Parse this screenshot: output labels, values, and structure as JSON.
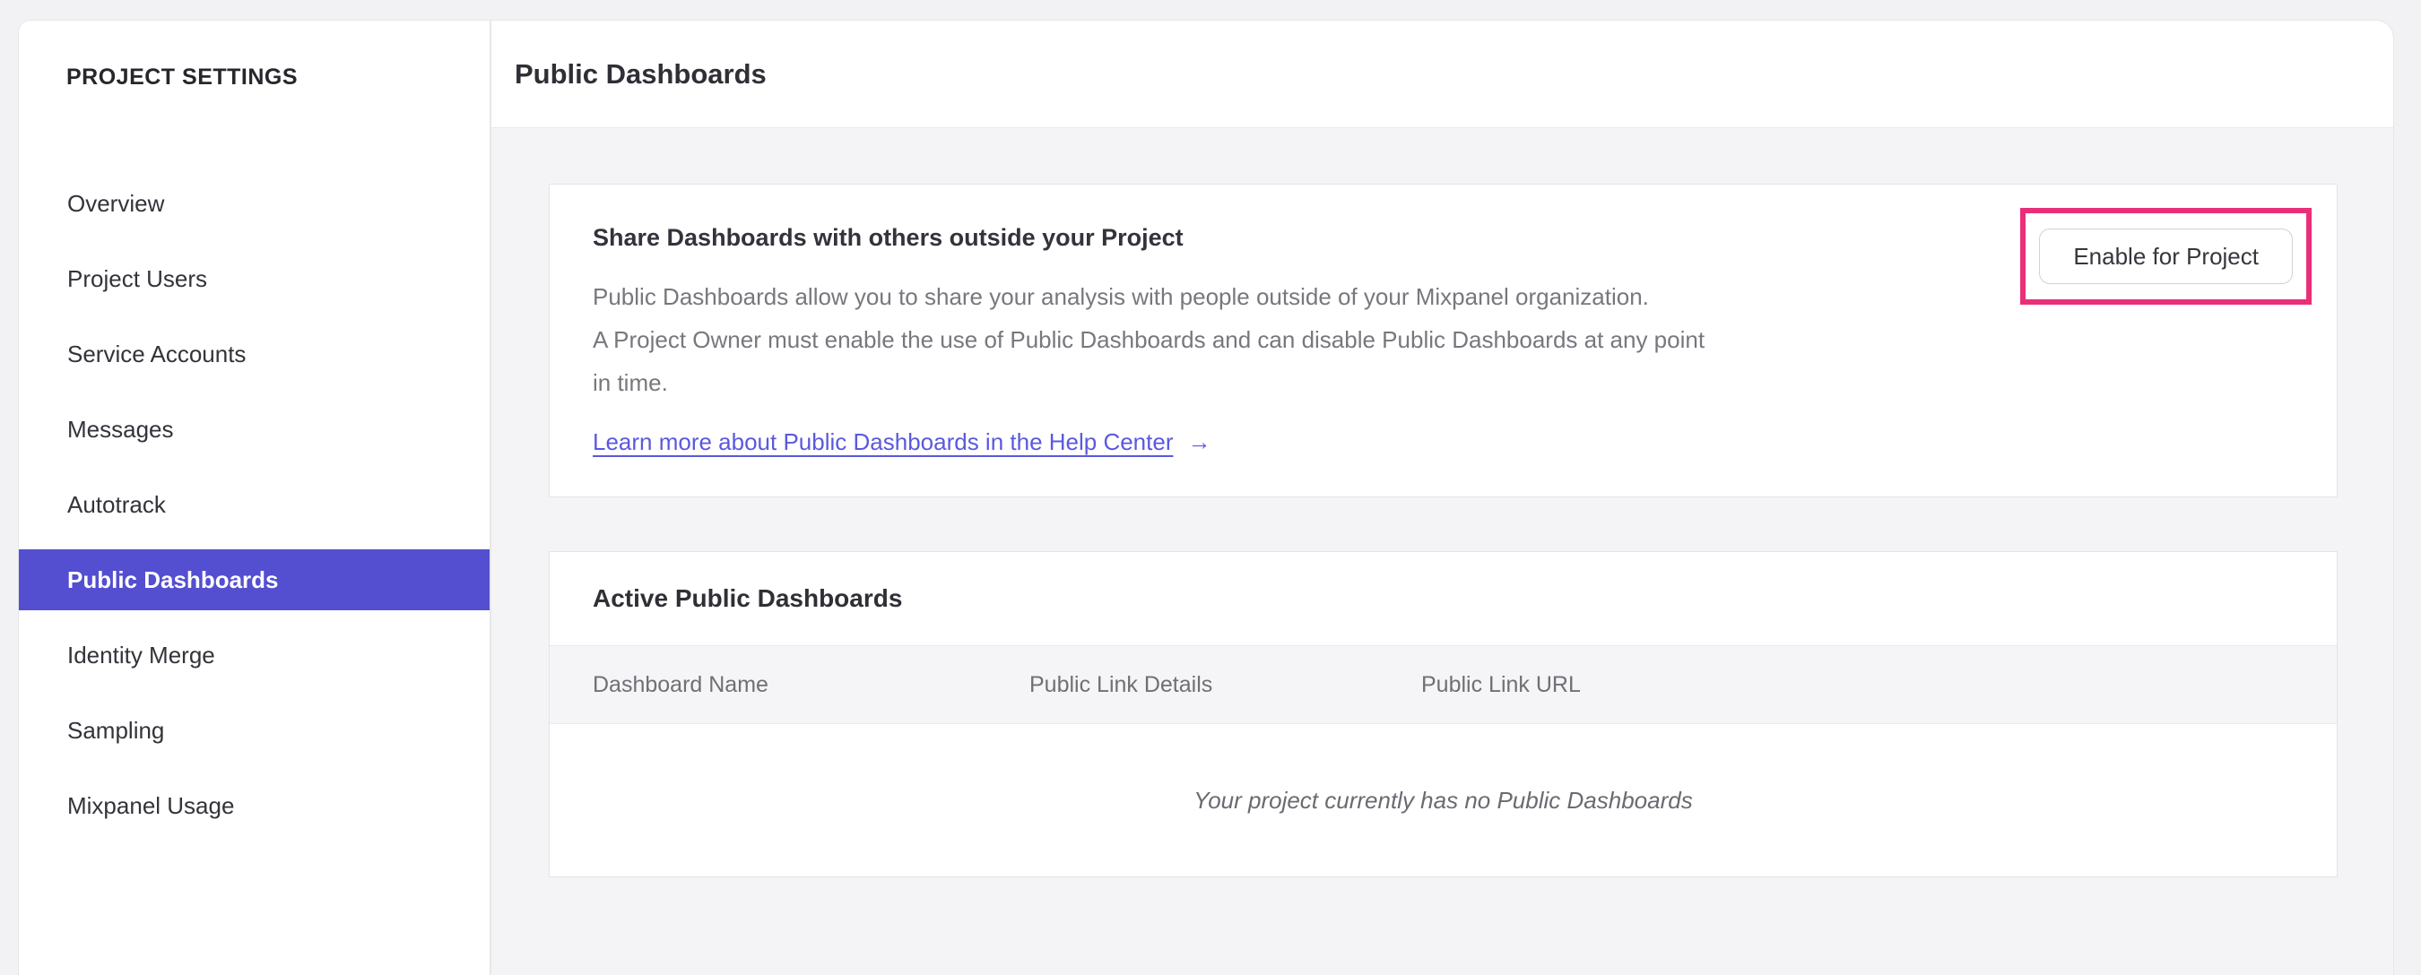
{
  "sidebar": {
    "title": "PROJECT SETTINGS",
    "items": [
      {
        "label": "Overview",
        "active": false
      },
      {
        "label": "Project Users",
        "active": false
      },
      {
        "label": "Service Accounts",
        "active": false
      },
      {
        "label": "Messages",
        "active": false
      },
      {
        "label": "Autotrack",
        "active": false
      },
      {
        "label": "Public Dashboards",
        "active": true
      },
      {
        "label": "Identity Merge",
        "active": false
      },
      {
        "label": "Sampling",
        "active": false
      },
      {
        "label": "Mixpanel Usage",
        "active": false
      }
    ]
  },
  "header": {
    "title": "Public Dashboards"
  },
  "share_card": {
    "heading": "Share Dashboards with others outside your Project",
    "body_lines": [
      "Public Dashboards allow you to share your analysis with people outside of your Mixpanel organization.",
      "A Project Owner must enable the use of Public Dashboards and can disable Public Dashboards at any point",
      "in time."
    ],
    "link_label": "Learn more about Public Dashboards in the Help Center",
    "link_arrow": "→",
    "enable_button_label": "Enable for Project"
  },
  "dashboards_card": {
    "heading": "Active Public Dashboards",
    "columns": [
      "Dashboard Name",
      "Public Link Details",
      "Public Link URL"
    ],
    "rows": [],
    "empty_message": "Your project currently has no Public Dashboards"
  },
  "colors": {
    "accent_purple": "#544ed0",
    "link_blue": "#5a59df",
    "annotation_pink": "#ea2f79"
  }
}
